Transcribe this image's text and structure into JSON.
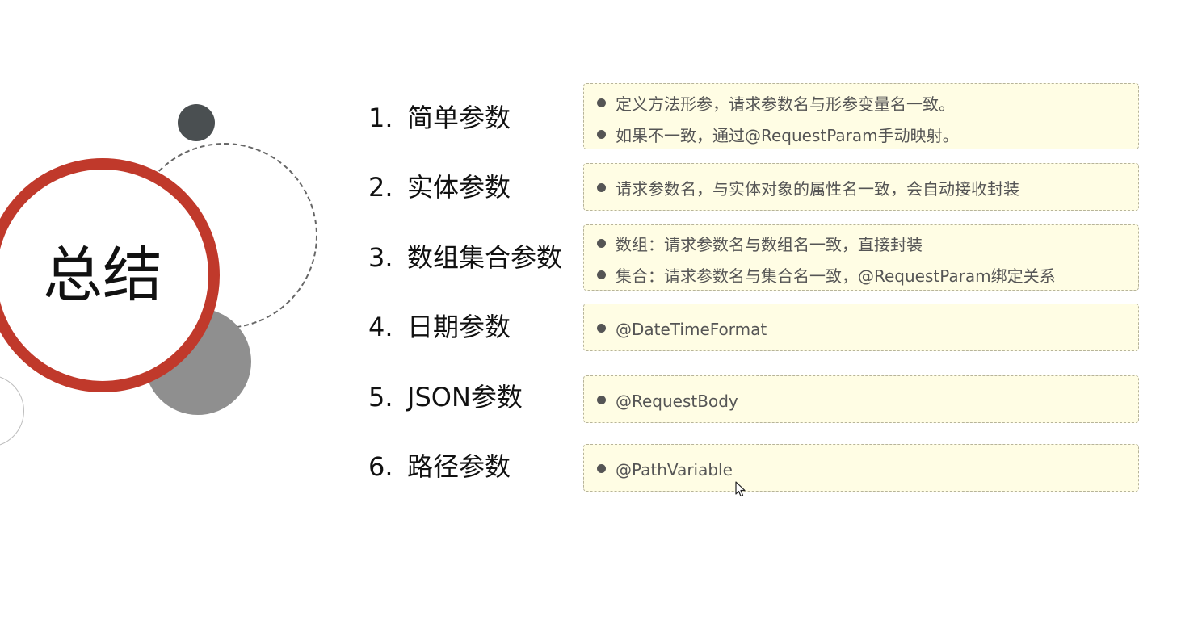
{
  "title": "总结",
  "items": [
    {
      "number": "1.",
      "label": "简单参数",
      "bullets": [
        "定义方法形参，请求参数名与形参变量名一致。",
        "如果不一致，通过@RequestParam手动映射。"
      ]
    },
    {
      "number": "2.",
      "label": "实体参数",
      "bullets": [
        "请求参数名，与实体对象的属性名一致，会自动接收封装"
      ]
    },
    {
      "number": "3.",
      "label": "数组集合参数",
      "bullets": [
        "数组：请求参数名与数组名一致，直接封装",
        "集合：请求参数名与集合名一致，@RequestParam绑定关系"
      ]
    },
    {
      "number": "4.",
      "label": "日期参数",
      "bullets": [
        "@DateTimeFormat"
      ]
    },
    {
      "number": "5.",
      "label": "JSON参数",
      "bullets": [
        "@RequestBody"
      ]
    },
    {
      "number": "6.",
      "label": "路径参数",
      "bullets": [
        "@PathVariable"
      ]
    }
  ],
  "colors": {
    "accent_ring": "#c0392b",
    "box_fill": "#fffde4",
    "box_border": "#b7b49a",
    "dark_dot": "#4a4f51",
    "gray_disc": "#8f8f8f"
  },
  "icons": {
    "cursor": "mouse-pointer-icon",
    "bullet": "bullet-dot-icon"
  }
}
